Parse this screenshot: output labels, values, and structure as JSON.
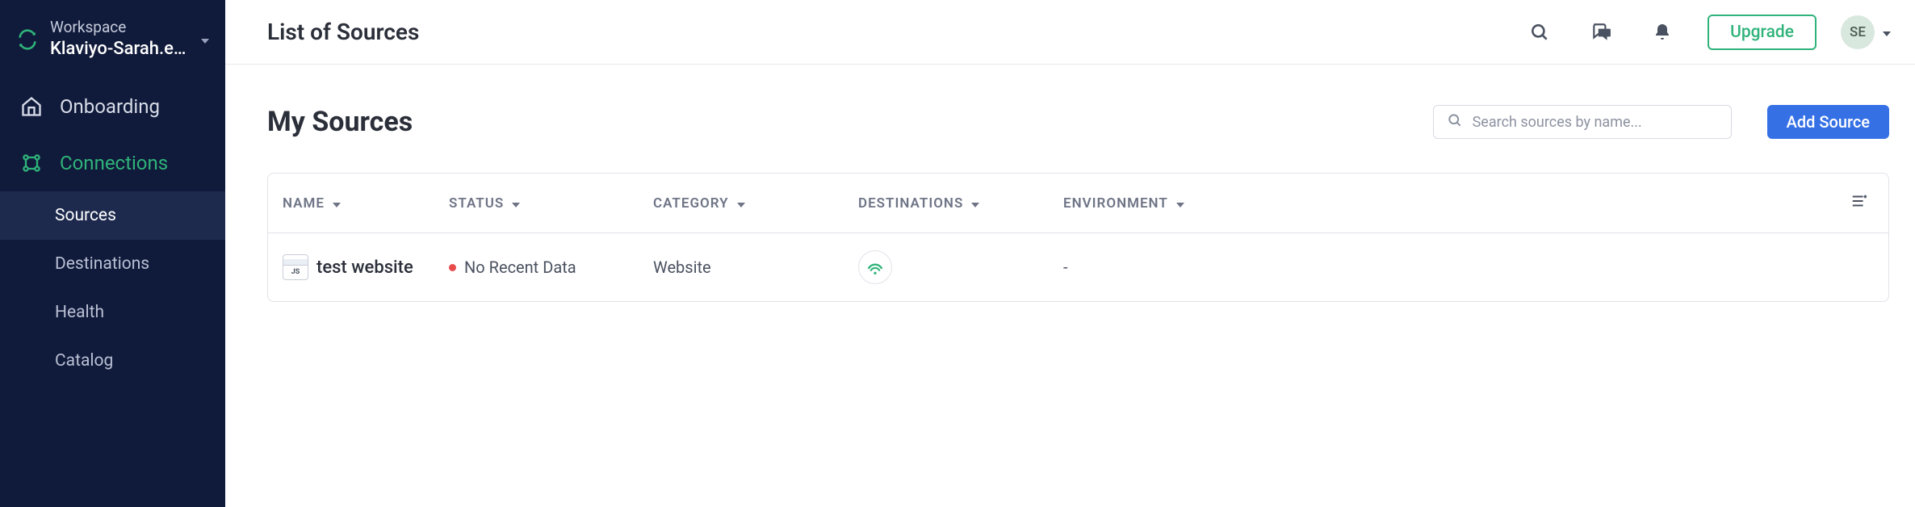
{
  "workspace": {
    "label": "Workspace",
    "name": "Klaviyo-Sarah.eb..."
  },
  "sidebar": {
    "onboarding": "Onboarding",
    "connections": "Connections",
    "subnav": {
      "sources": "Sources",
      "destinations": "Destinations",
      "health": "Health",
      "catalog": "Catalog"
    }
  },
  "topbar": {
    "title": "List of Sources",
    "upgrade": "Upgrade",
    "avatar": "SE"
  },
  "content": {
    "heading": "My Sources",
    "search_placeholder": "Search sources by name...",
    "add_button": "Add Source",
    "columns": {
      "name": "NAME",
      "status": "STATUS",
      "category": "CATEGORY",
      "destinations": "DESTINATIONS",
      "environment": "ENVIRONMENT"
    },
    "rows": [
      {
        "name": "test website",
        "status": "No Recent Data",
        "category": "Website",
        "environment": "-"
      }
    ]
  }
}
